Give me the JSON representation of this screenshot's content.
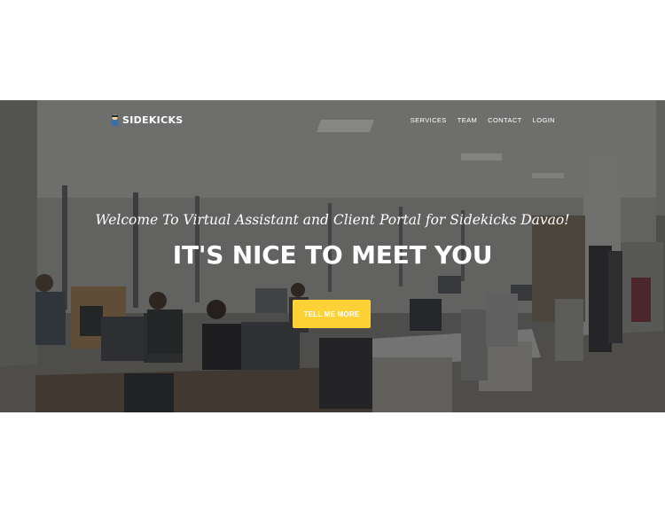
{
  "brand": {
    "name": "SIDEKICKS",
    "logo_icon": "sidekick-mascot-icon"
  },
  "nav": {
    "items": [
      {
        "label": "SERVICES"
      },
      {
        "label": "TEAM"
      },
      {
        "label": "CONTACT"
      },
      {
        "label": "LOGIN"
      }
    ]
  },
  "hero": {
    "lead": "Welcome To Virtual Assistant and Client Portal for Sidekicks Davao!",
    "heading": "IT'S NICE TO MEET YOU",
    "cta_label": "TELL ME MORE",
    "background": "open-plan-office-photo"
  },
  "colors": {
    "accent": "#fed136",
    "text": "#ffffff",
    "overlay": "#191919"
  }
}
